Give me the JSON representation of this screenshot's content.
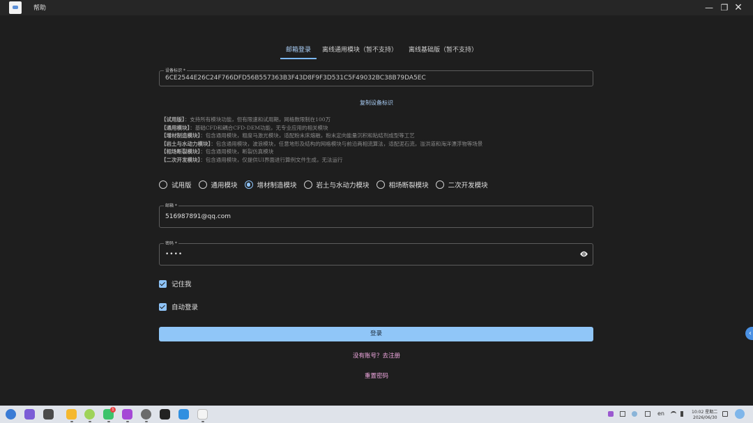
{
  "titlebar": {
    "menu_help": "帮助",
    "minimize": "—",
    "maximize": "❐",
    "close": "✕"
  },
  "tabs": [
    {
      "label": "邮箱登录",
      "active": true
    },
    {
      "label": "离线通用模块（暂不支持）",
      "active": false
    },
    {
      "label": "离线基础版（暂不支持）",
      "active": false
    }
  ],
  "device": {
    "label": "设备标识 *",
    "value": "6CE2544E26C24F766DFD56B557363B3F43D8F9F3D531C5F49032BC38B79DA5EC"
  },
  "copy_device_label": "复制设备标识",
  "descriptions": [
    {
      "title": "【试用版】",
      "text": "：支持所有模块功能，但有限速和试用期，网格数限制在100万"
    },
    {
      "title": "【通用模块】",
      "text": "：基础CFD和耦合CFD-DEM功能，无专业应用的相关模块"
    },
    {
      "title": "【增材制造模块】",
      "text": "：包含通用模块，粗度马激光模块，适配粉末床熔融，粉末定向能量沉积和粘结剂成型等工艺"
    },
    {
      "title": "【岩土与水动力模块】",
      "text": "：包含通用模块，波浪模块，任意地形及结构的网格模块与前沿两相流算法，适配泥石流，溢洪道和海洋漂浮物等场景"
    },
    {
      "title": "【相场断裂模块】",
      "text": "：包含通用模块，断裂仿真模块"
    },
    {
      "title": "【二次开发模块】",
      "text": "：包含通用模块，仅提供UI界面进行算例文件生成，无法运行"
    }
  ],
  "module_options": [
    {
      "label": "试用版",
      "checked": false
    },
    {
      "label": "通用模块",
      "checked": false
    },
    {
      "label": "增材制造模块",
      "checked": true
    },
    {
      "label": "岩土与水动力模块",
      "checked": false
    },
    {
      "label": "相场断裂模块",
      "checked": false
    },
    {
      "label": "二次开发模块",
      "checked": false
    }
  ],
  "email": {
    "label": "邮箱 *",
    "value": "516987891@qq.com"
  },
  "password": {
    "label": "密码 *",
    "value": "••••"
  },
  "remember_me": {
    "label": "记住我",
    "checked": true
  },
  "auto_login": {
    "label": "自动登录",
    "checked": true
  },
  "login_button": "登录",
  "register_link": "没有账号？去注册",
  "reset_link": "重置密码",
  "taskbar": {
    "lang": "en",
    "time": "10:02 星期二",
    "date": "2026/06/30",
    "notification_badge": "1"
  },
  "colors": {
    "accent": "#90c6f8",
    "link_pink": "#f0a8e0",
    "background": "#1e1e1e"
  }
}
